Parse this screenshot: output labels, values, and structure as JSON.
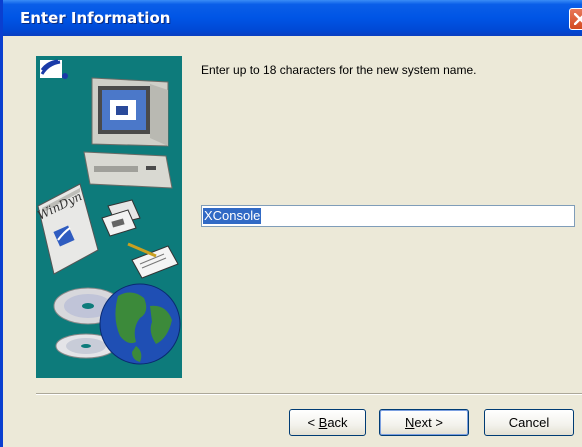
{
  "window": {
    "title": "Enter Information",
    "close_icon": "close-icon"
  },
  "side_panel": {
    "book_label": "WinDyn",
    "icons": [
      "app-logo-icon",
      "computer-icon",
      "book-icon",
      "diskette-icon",
      "document-pen-icon",
      "cd-icon",
      "globe-icon"
    ]
  },
  "content": {
    "prompt": "Enter up to 18 characters for the new system name.",
    "name_field": {
      "value": "XConsole",
      "selected": true
    }
  },
  "buttons": {
    "back": {
      "hotkey": "B",
      "rest": "ack",
      "prefix": "< "
    },
    "next": {
      "hotkey": "N",
      "rest": "ext",
      "suffix": " >"
    },
    "cancel": {
      "label": "Cancel"
    }
  },
  "colors": {
    "titlebar": "#0055e5",
    "dialog_bg": "#ece9d8",
    "side_panel_bg": "#0d7b7b",
    "selection": "#316ac5",
    "close_button": "#d34a20"
  }
}
